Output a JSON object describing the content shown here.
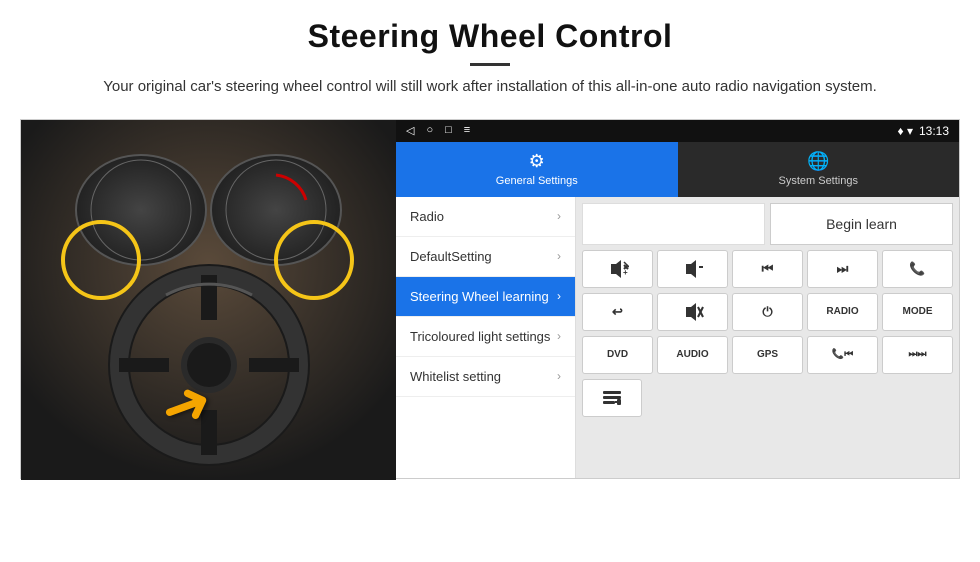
{
  "header": {
    "title": "Steering Wheel Control",
    "subtitle": "Your original car's steering wheel control will still work after installation of this all-in-one auto radio navigation system."
  },
  "statusBar": {
    "navIcon": "◁",
    "homeIcon": "○",
    "squareIcon": "□",
    "menuIcon": "≡",
    "signalIcon": "♦",
    "wifiIcon": "▼",
    "time": "13:13"
  },
  "tabs": [
    {
      "label": "General Settings",
      "icon": "⚙",
      "active": true
    },
    {
      "label": "System Settings",
      "icon": "🌐",
      "active": false
    }
  ],
  "menu": {
    "items": [
      {
        "label": "Radio",
        "active": false
      },
      {
        "label": "DefaultSetting",
        "active": false
      },
      {
        "label": "Steering Wheel learning",
        "active": true
      },
      {
        "label": "Tricoloured light settings",
        "active": false
      },
      {
        "label": "Whitelist setting",
        "active": false
      }
    ]
  },
  "controls": {
    "beginLearnLabel": "Begin learn",
    "row1": [
      "🔊+",
      "🔊−",
      "⏮",
      "⏭",
      "📞"
    ],
    "row2": [
      "↩",
      "🔊✕",
      "⏻",
      "RADIO",
      "MODE"
    ],
    "row3": [
      "DVD",
      "AUDIO",
      "GPS",
      "📞⏮",
      "⏭⏭"
    ],
    "listIcon": "≡"
  }
}
